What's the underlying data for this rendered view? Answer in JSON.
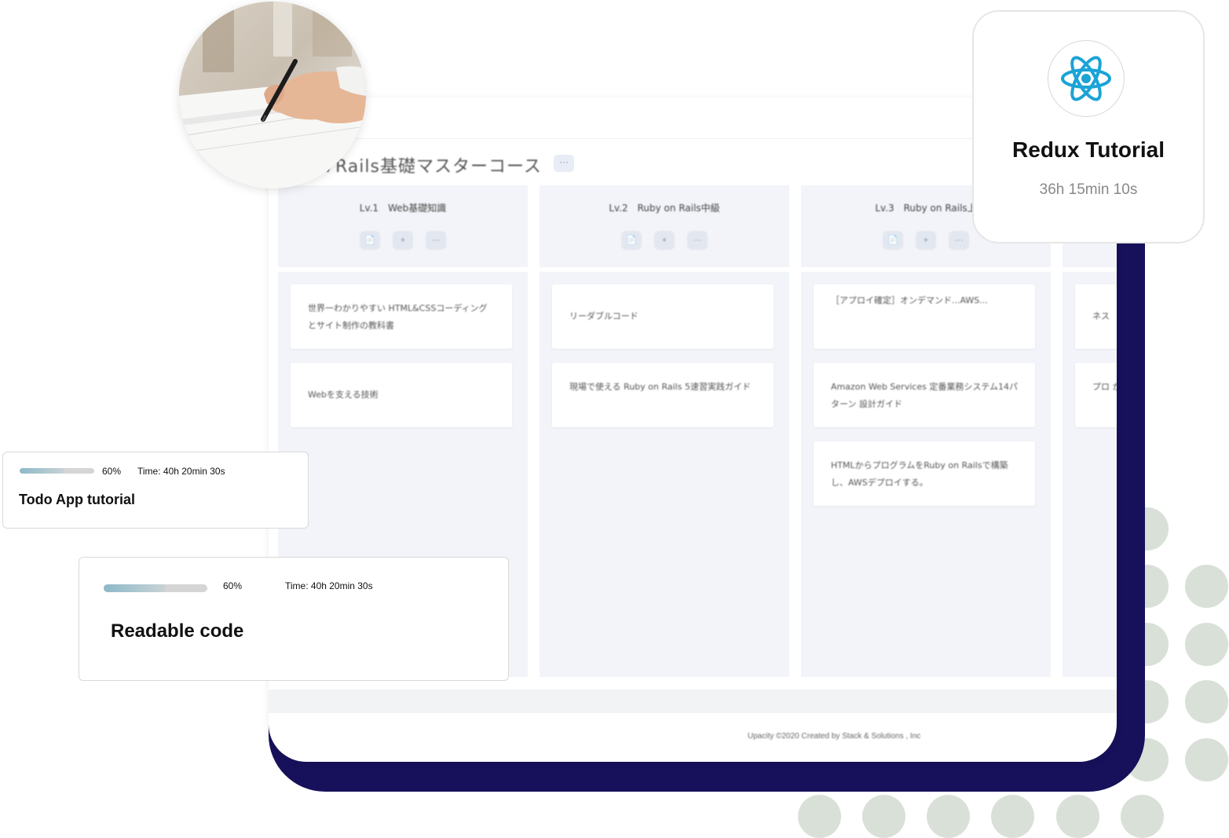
{
  "board": {
    "title": "7Rails基礎マスターコース",
    "menu_label": "···",
    "footer": "Upacity ©2020 Created by Stack & Solutions , Inc",
    "columns": [
      {
        "title": "Lv.1　Web基礎知識",
        "icons": [
          "📄",
          "+",
          "···"
        ],
        "cards": [
          "世界一わかりやすい HTML&CSSコーディングとサイト制作の教科書",
          "Webを支える技術"
        ]
      },
      {
        "title": "Lv.2　Ruby on Rails中級",
        "icons": [
          "📄",
          "+",
          "···"
        ],
        "cards": [
          "リーダブルコード",
          "現場で使える Ruby on Rails 5速習実践ガイド"
        ]
      },
      {
        "title": "Lv.3　Ruby on Rails上",
        "icons": [
          "📄",
          "+",
          "···"
        ],
        "cards": [
          "［アプロイ確定］オンデマンド...AWS...",
          "Amazon Web Services 定番業務システム14パターン 設計ガイド",
          "HTMLからプログラムをRuby on Railsで構築し、AWSデプロイする。"
        ]
      },
      {
        "title": "",
        "icons": [],
        "cards": [
          "ネス",
          "プロ からい"
        ]
      }
    ]
  },
  "redux_card": {
    "icon": "react-atom-icon",
    "title": "Redux Tutorial",
    "time": "36h 15min 10s"
  },
  "todo_card": {
    "progress": 0.6,
    "percent": "60%",
    "time": "Time: 40h 20min 30s",
    "title": "Todo App tutorial"
  },
  "readable_card": {
    "progress": 0.6,
    "percent": "60%",
    "time": "Time: 40h 20min 30s",
    "title": "Readable code"
  },
  "colors": {
    "navy": "#16115a",
    "dot": "#d9e0d8",
    "react": "#1ba3d6",
    "progress": "#8db9c9"
  }
}
